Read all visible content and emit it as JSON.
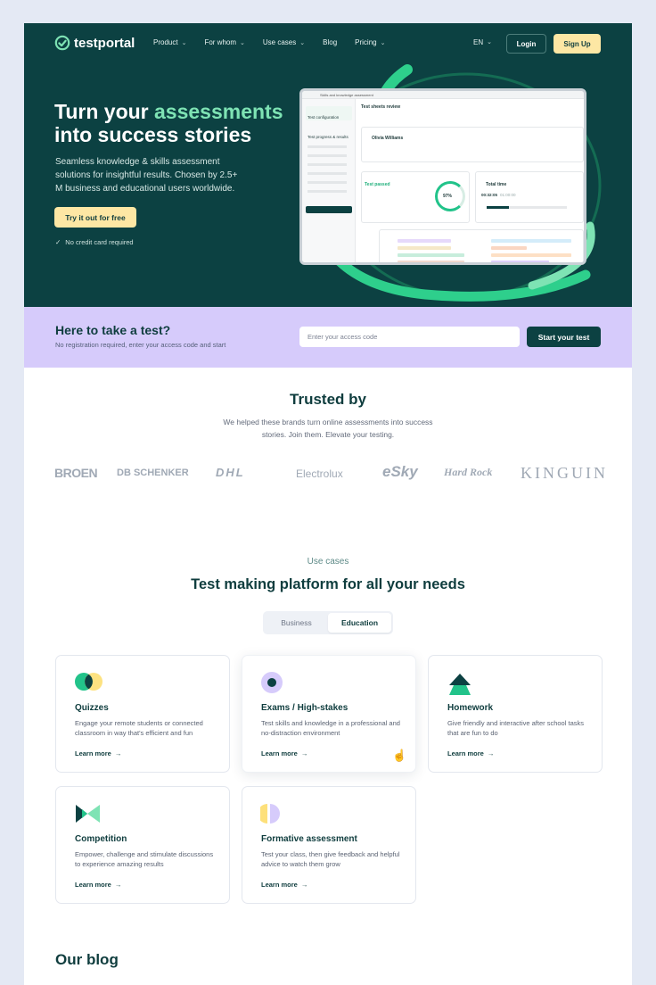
{
  "nav": {
    "brand": "testportal",
    "items": [
      {
        "label": "Product",
        "dropdown": true
      },
      {
        "label": "For whom",
        "dropdown": true
      },
      {
        "label": "Use cases",
        "dropdown": true
      },
      {
        "label": "Blog",
        "dropdown": false
      },
      {
        "label": "Pricing",
        "dropdown": true
      }
    ],
    "language": "EN",
    "login": "Login",
    "signup": "Sign Up"
  },
  "hero": {
    "title_part1": "Turn your ",
    "title_accent": "assessments",
    "title_part2": "into success stories",
    "subtitle": "Seamless knowledge & skills assessment solutions for insightful results. Chosen by 2.5+ M business and educational users worldwide.",
    "cta": "Try it out for free",
    "note": "No credit card required"
  },
  "mockup": {
    "window_title": "Skills and knowledge assessment",
    "panel_title": "Test sheets review",
    "respondent": "Olivia Williams",
    "status": "Test passed",
    "score": "97%",
    "time_label": "Total time",
    "time_value": "00:32:05",
    "time_limit": "01:00:00",
    "side_items": [
      "Test configuration",
      "Test progress & results"
    ]
  },
  "take_test": {
    "title": "Here to take a test?",
    "subtitle": "No registration required, enter your access code and start",
    "input_placeholder": "Enter your access code",
    "button": "Start your test"
  },
  "trusted": {
    "title": "Trusted by",
    "subtitle": "We helped these brands turn online assessments into success stories. Join them. Elevate your testing.",
    "brands": [
      "BROEN",
      "DB SCHENKER",
      "DHL",
      "Electrolux",
      "eSky",
      "Hard Rock",
      "KINGUIN"
    ]
  },
  "use_cases": {
    "kicker": "Use cases",
    "title": "Test making platform for all your needs",
    "tabs": [
      "Business",
      "Education"
    ],
    "active_tab": "Education",
    "link_label": "Learn more",
    "cards": [
      {
        "title": "Quizzes",
        "desc": "Engage your remote students or connected classroom in way that's efficient and fun"
      },
      {
        "title": "Exams / High-stakes",
        "desc": "Test skills and knowledge in a professional and no-distraction environment"
      },
      {
        "title": "Homework",
        "desc": "Give friendly and interactive after school tasks that are fun to do"
      },
      {
        "title": "Competition",
        "desc": "Empower, challenge and stimulate discussions to experience amazing results"
      },
      {
        "title": "Formative assessment",
        "desc": "Test your class, then give feedback and helpful advice to watch them grow"
      }
    ]
  },
  "blog": {
    "title": "Our blog"
  },
  "colors": {
    "primary": "#0c4142",
    "accent_green": "#7ee3b4",
    "cta_yellow": "#fde7a4",
    "lavender": "#d6cbfb"
  }
}
